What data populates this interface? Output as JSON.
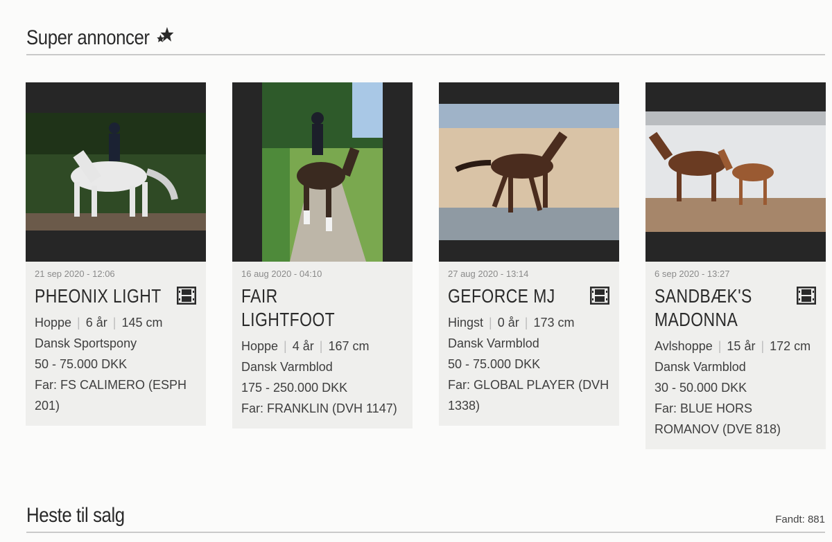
{
  "sections": {
    "super_title": "Super annoncer",
    "sale_title": "Heste til salg",
    "found_label": "Fandt:",
    "found_count": "881"
  },
  "cards": [
    {
      "date": "21 sep 2020 - 12:06",
      "name": "PHEONIX LIGHT",
      "gender": "Hoppe",
      "age": "6 år",
      "height": "145 cm",
      "breed": "Dansk Sportspony",
      "price": "50 - 75.000 DKK",
      "sire": "Far: FS CALIMERO (ESPH 201)",
      "has_video": true
    },
    {
      "date": "16 aug 2020 - 04:10",
      "name": "FAIR LIGHTFOOT",
      "gender": "Hoppe",
      "age": "4 år",
      "height": "167 cm",
      "breed": "Dansk Varmblod",
      "price": "175 - 250.000 DKK",
      "sire": "Far: FRANKLIN (DVH 1147)",
      "has_video": false
    },
    {
      "date": "27 aug 2020 - 13:14",
      "name": "GEFORCE MJ",
      "gender": "Hingst",
      "age": "0 år",
      "height": "173 cm",
      "breed": "Dansk Varmblod",
      "price": "50 - 75.000 DKK",
      "sire": "Far: GLOBAL PLAYER (DVH 1338)",
      "has_video": true
    },
    {
      "date": "6 sep 2020 - 13:27",
      "name": "SANDBÆK'S MADONNA",
      "gender": "Avlshoppe",
      "age": "15 år",
      "height": "172 cm",
      "breed": "Dansk Varmblod",
      "price": "30 - 50.000 DKK",
      "sire": "Far: BLUE HORS ROMANOV (DVE 818)",
      "has_video": true
    }
  ],
  "icons": {
    "stars": "stars-icon",
    "video": "film-icon"
  }
}
